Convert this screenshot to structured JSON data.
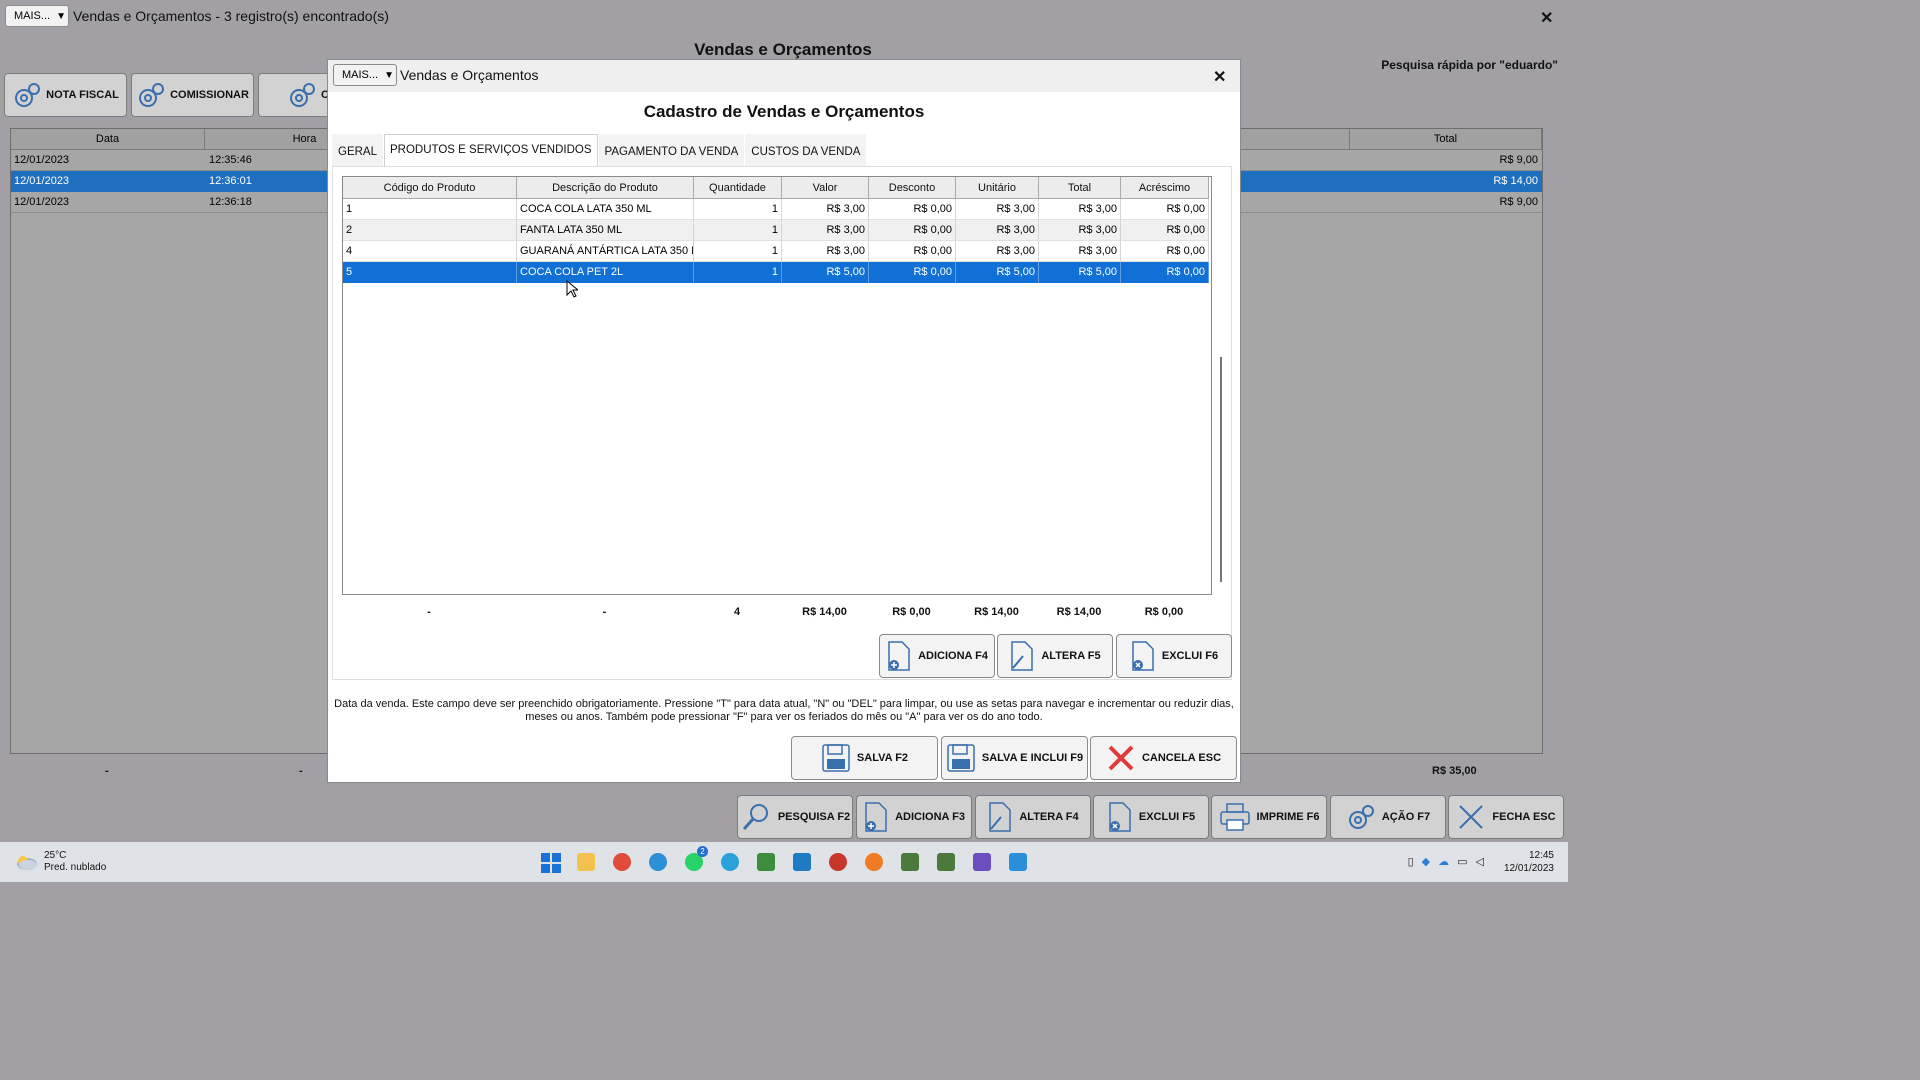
{
  "main_window": {
    "mais_label": "MAIS...",
    "title": "Vendas e Orçamentos - 3 registro(s) encontrado(s)",
    "close": "✕",
    "heading": "Vendas e Orçamentos",
    "quick_search": "Pesquisa rápida por \"eduardo\"",
    "toolbar": [
      "NOTA FISCAL",
      "COMISSIONAR",
      "C"
    ],
    "table": {
      "columns": [
        "Data",
        "Hora",
        "Total"
      ],
      "rows": [
        {
          "date": "12/01/2023",
          "time": "12:35:46",
          "total": "R$ 9,00",
          "selected": false
        },
        {
          "date": "12/01/2023",
          "time": "12:36:01",
          "total": "R$ 14,00",
          "selected": true
        },
        {
          "date": "12/01/2023",
          "time": "12:36:18",
          "total": "R$ 9,00",
          "selected": false
        }
      ],
      "footer": {
        "c1": "-",
        "c2": "-",
        "total": "R$ 35,00"
      }
    },
    "bottom_buttons": [
      "PESQUISA F2",
      "ADICIONA F3",
      "ALTERA F4",
      "EXCLUI F5",
      "IMPRIME F6",
      "AÇÃO F7",
      "FECHA ESC"
    ]
  },
  "modal": {
    "mais_label": "MAIS...",
    "title": "Vendas e Orçamentos",
    "close": "✕",
    "heading": "Cadastro de Vendas e Orçamentos",
    "tabs": [
      "GERAL",
      "PRODUTOS E SERVIÇOS VENDIDOS",
      "PAGAMENTO DA VENDA",
      "CUSTOS DA VENDA"
    ],
    "active_tab": 1,
    "grid": {
      "columns": [
        "Código do Produto",
        "Descrição do Produto",
        "Quantidade",
        "Valor",
        "Desconto",
        "Unitário",
        "Total",
        "Acréscimo"
      ],
      "rows": [
        {
          "code": "1",
          "desc": "COCA COLA LATA 350 ML",
          "qty": "1",
          "valor": "R$ 3,00",
          "desconto": "R$ 0,00",
          "unitario": "R$ 3,00",
          "total": "R$ 3,00",
          "acrescimo": "R$ 0,00"
        },
        {
          "code": "2",
          "desc": "FANTA LATA 350 ML",
          "qty": "1",
          "valor": "R$ 3,00",
          "desconto": "R$ 0,00",
          "unitario": "R$ 3,00",
          "total": "R$ 3,00",
          "acrescimo": "R$ 0,00"
        },
        {
          "code": "4",
          "desc": "GUARANÁ ANTÁRTICA LATA 350 M",
          "qty": "1",
          "valor": "R$ 3,00",
          "desconto": "R$ 0,00",
          "unitario": "R$ 3,00",
          "total": "R$ 3,00",
          "acrescimo": "R$ 0,00"
        },
        {
          "code": "5",
          "desc": "COCA COLA PET 2L",
          "qty": "1",
          "valor": "R$ 5,00",
          "desconto": "R$ 0,00",
          "unitario": "R$ 5,00",
          "total": "R$ 5,00",
          "acrescimo": "R$ 0,00"
        }
      ],
      "selected_row": 3,
      "totals": {
        "code": "-",
        "desc": "-",
        "qty": "4",
        "valor": "R$ 14,00",
        "desconto": "R$ 0,00",
        "unitario": "R$ 14,00",
        "total": "R$ 14,00",
        "acrescimo": "R$ 0,00"
      }
    },
    "grid_buttons": [
      "ADICIONA F4",
      "ALTERA F5",
      "EXCLUI F6"
    ],
    "help_text": "Data da venda. Este campo deve ser preenchido obrigatoriamente. Pressione \"T\" para data atual, \"N\" ou \"DEL\" para limpar, ou use as setas para navegar e incrementar ou reduzir dias, meses ou anos. Também pode pressionar \"F\" para ver os feriados do mês ou \"A\" para ver os do ano todo.",
    "footer_buttons": [
      "SALVA F2",
      "SALVA E INCLUI F9",
      "CANCELA ESC"
    ]
  },
  "taskbar": {
    "weather_temp": "25°C",
    "weather_desc": "Pred. nublado",
    "time": "12:45",
    "date": "12/01/2023",
    "whatsapp_badge": "2"
  },
  "colors": {
    "selection": "#1170d6",
    "background_dim": "#a2a0a4",
    "cancel_red": "#e03a3a"
  }
}
